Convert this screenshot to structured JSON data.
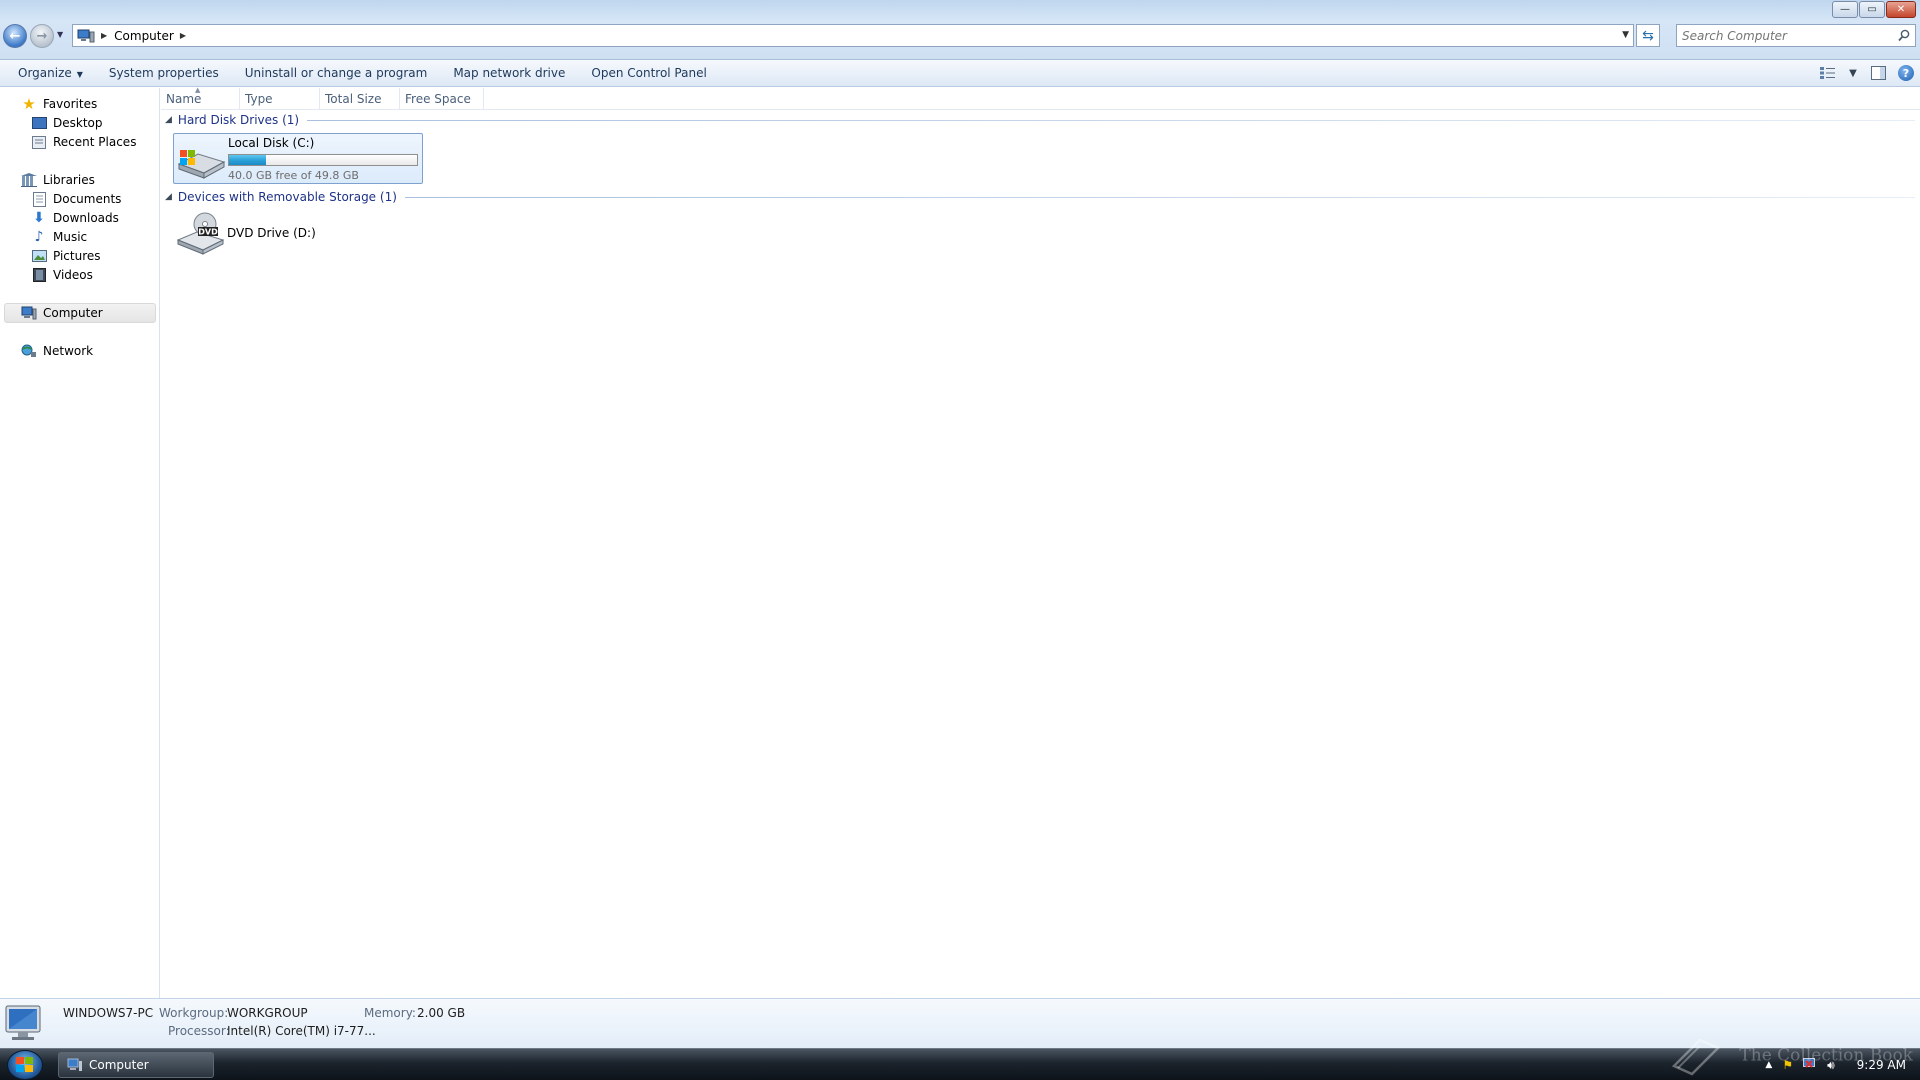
{
  "window": {
    "breadcrumb": [
      "Computer"
    ],
    "search_placeholder": "Search Computer",
    "controls": {
      "minimize": "—",
      "maximize": "▭",
      "close": "✕"
    }
  },
  "commandbar": {
    "items": [
      "Organize",
      "System properties",
      "Uninstall or change a program",
      "Map network drive",
      "Open Control Panel"
    ]
  },
  "nav": {
    "favorites": {
      "label": "Favorites",
      "items": [
        "Desktop",
        "Recent Places"
      ]
    },
    "libraries": {
      "label": "Libraries",
      "items": [
        "Documents",
        "Downloads",
        "Music",
        "Pictures",
        "Videos"
      ]
    },
    "computer": "Computer",
    "network": "Network"
  },
  "columns": [
    "Name",
    "Type",
    "Total Size",
    "Free Space"
  ],
  "groups": {
    "hdd": {
      "label": "Hard Disk Drives (1)",
      "drive": {
        "name": "Local Disk (C:)",
        "free_text": "40.0 GB free of 49.8 GB",
        "used_fraction": 0.197
      }
    },
    "removable": {
      "label": "Devices with Removable Storage (1)",
      "drive": {
        "name": "DVD Drive (D:)",
        "badge": "DVD"
      }
    }
  },
  "details": {
    "computer_name": "WINDOWS7-PC",
    "workgroup_label": "Workgroup:",
    "workgroup": "WORKGROUP",
    "memory_label": "Memory:",
    "memory": "2.00 GB",
    "processor_label": "Processor:",
    "processor": "Intel(R) Core(TM) i7-77..."
  },
  "taskbar": {
    "task": "Computer",
    "time": "9:29 AM",
    "watermark": "The Collection Book"
  },
  "colors": {
    "accent": "#1e3287",
    "bar_fill": "#2a9fd8",
    "chrome": "#d6e6f7"
  }
}
